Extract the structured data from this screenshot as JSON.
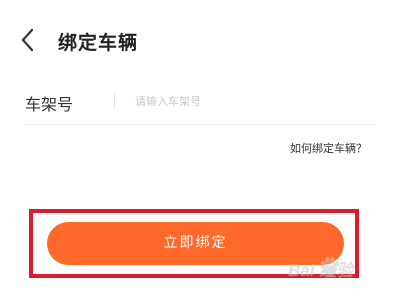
{
  "header": {
    "title": "绑定车辆",
    "back_icon": "chevron-left-icon"
  },
  "form": {
    "vin_label": "车架号",
    "vin_placeholder": "请输入车架号",
    "vin_value": ""
  },
  "help": {
    "link_text": "如何绑定车辆？"
  },
  "actions": {
    "bind_label": "立即绑定"
  },
  "watermark": {
    "text": "Bai 经验"
  },
  "colors": {
    "accent": "#ff6a2b",
    "highlight_border": "#d81e2c",
    "text_primary": "#222222",
    "placeholder": "#c8c8c8"
  }
}
